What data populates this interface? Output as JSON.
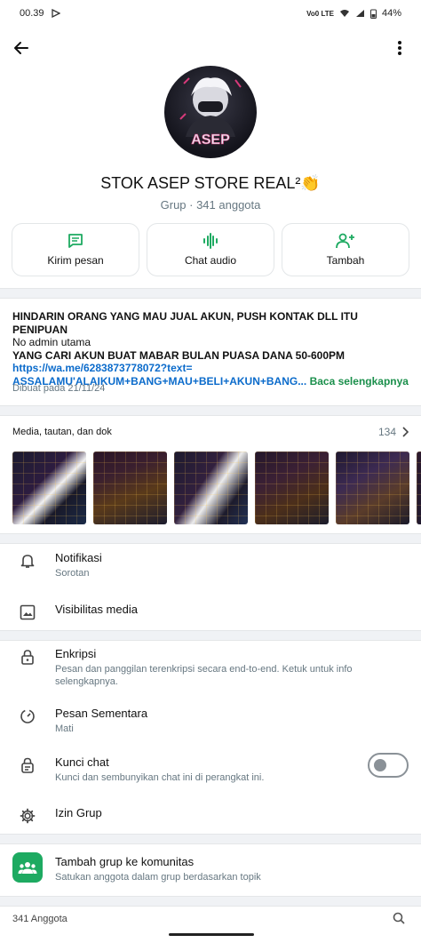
{
  "status_bar": {
    "time": "00.39",
    "net_label": "Vo0 LTE",
    "battery": "44%"
  },
  "header": {
    "group_name": "STOK ASEP STORE REAL²👏",
    "group_subtitle": "Grup · 341 anggota",
    "avatar_text": "ASEP"
  },
  "actions": [
    {
      "label": "Kirim pesan",
      "icon": "message-icon"
    },
    {
      "label": "Chat audio",
      "icon": "audio-wave-icon"
    },
    {
      "label": "Tambah",
      "icon": "add-person-icon"
    }
  ],
  "description": {
    "line1": "HINDARIN ORANG YANG MAU JUAL AKUN, PUSH KONTAK DLL ITU PENIPUAN",
    "line2": "No admin utama",
    "line3": "YANG CARI AKUN BUAT MABAR BULAN PUASA DANA 50-600PM",
    "link1": "https://wa.me/6283873778072?text=",
    "link2": "ASSALAMU'ALAIKUM+BANG+MAU+BELI+AKUN+BANG...",
    "read_more": "Baca selengkapnya",
    "created": "Dibuat pada 21/11/24"
  },
  "media": {
    "title": "Media, tautan, dan dok",
    "count": "134"
  },
  "settings": {
    "notifications": {
      "title": "Notifikasi",
      "subtitle": "Sorotan"
    },
    "media_visibility": {
      "title": "Visibilitas media"
    },
    "encryption": {
      "title": "Enkripsi",
      "subtitle": "Pesan dan panggilan terenkripsi secara end-to-end. Ketuk untuk info selengkapnya."
    },
    "disappearing": {
      "title": "Pesan Sementara",
      "subtitle": "Mati"
    },
    "chat_lock": {
      "title": "Kunci chat",
      "subtitle": "Kunci dan sembunyikan chat ini di perangkat ini.",
      "enabled": false
    },
    "group_permissions": {
      "title": "Izin Grup"
    },
    "community": {
      "title": "Tambah grup ke komunitas",
      "subtitle": "Satukan anggota dalam grup berdasarkan topik"
    }
  },
  "members": {
    "label": "341 Anggota"
  },
  "colors": {
    "accent_green": "#1daa61",
    "link_blue": "#0b6bcb",
    "secondary_text": "#667781"
  }
}
